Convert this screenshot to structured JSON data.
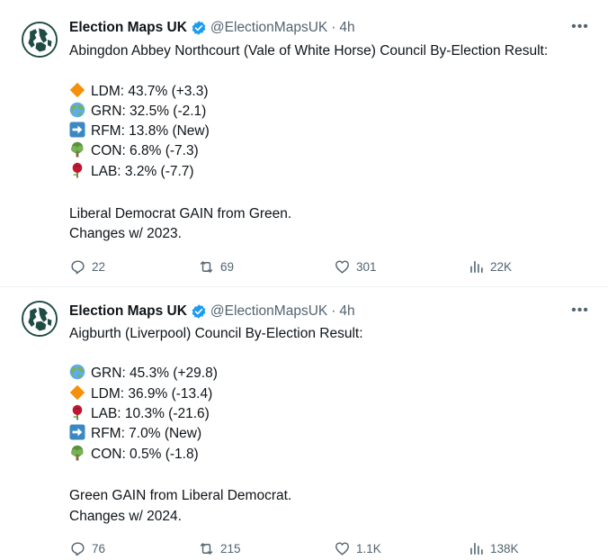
{
  "tweets": [
    {
      "author": "Election Maps UK",
      "handle": "@ElectionMapsUK",
      "separator": "·",
      "time": "4h",
      "title": "Abingdon Abbey Northcourt (Vale of White Horse) Council By-Election Result:",
      "results": [
        {
          "icon": "orange-diamond-icon",
          "text": "LDM: 43.7% (+3.3)"
        },
        {
          "icon": "globe-icon",
          "text": "GRN: 32.5% (-2.1)"
        },
        {
          "icon": "right-arrow-icon",
          "text": "RFM: 13.8% (New)"
        },
        {
          "icon": "tree-icon",
          "text": "CON: 6.8% (-7.3)"
        },
        {
          "icon": "rose-icon",
          "text": "LAB: 3.2% (-7.7)"
        }
      ],
      "summary": "Liberal Democrat GAIN from Green.",
      "changes": "Changes w/ 2023.",
      "replies": "22",
      "retweets": "69",
      "likes": "301",
      "views": "22K"
    },
    {
      "author": "Election Maps UK",
      "handle": "@ElectionMapsUK",
      "separator": "·",
      "time": "4h",
      "title": "Aigburth (Liverpool) Council By-Election Result:",
      "results": [
        {
          "icon": "globe-icon",
          "text": "GRN: 45.3% (+29.8)"
        },
        {
          "icon": "orange-diamond-icon",
          "text": "LDM: 36.9% (-13.4)"
        },
        {
          "icon": "rose-icon",
          "text": "LAB: 10.3% (-21.6)"
        },
        {
          "icon": "right-arrow-icon",
          "text": "RFM: 7.0% (New)"
        },
        {
          "icon": "tree-icon",
          "text": "CON: 0.5% (-1.8)"
        }
      ],
      "summary": "Green GAIN from Liberal Democrat.",
      "changes": "Changes w/ 2024.",
      "replies": "76",
      "retweets": "215",
      "likes": "1.1K",
      "views": "138K"
    }
  ],
  "colors": {
    "text": "#0f1419",
    "muted": "#536471",
    "verified": "#1d9bf0",
    "avatar": "#1f4d45"
  }
}
